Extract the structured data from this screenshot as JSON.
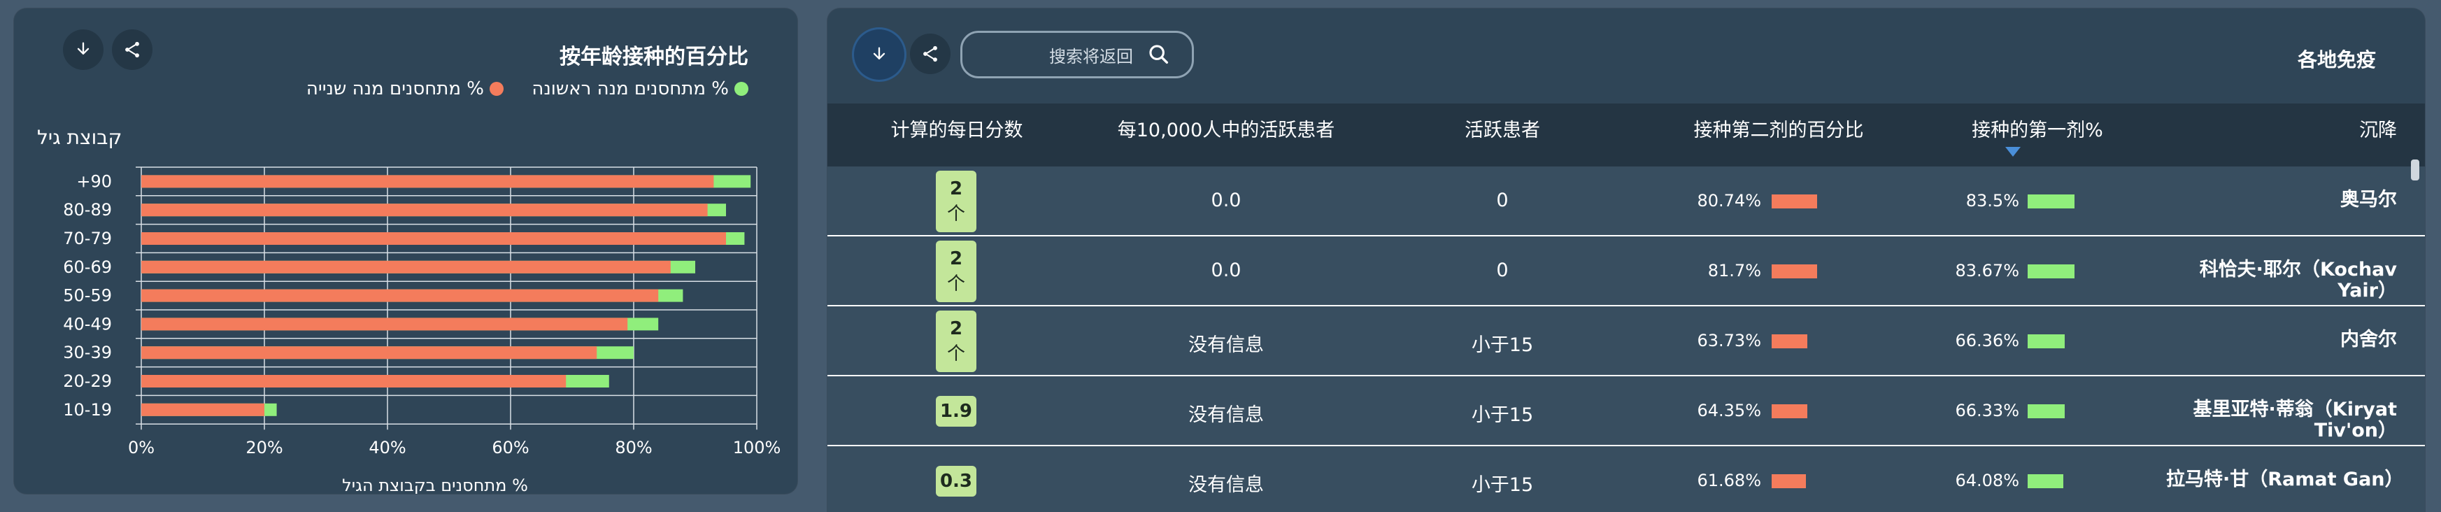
{
  "left_panel": {
    "title": "按年龄接种的百分比",
    "legend": [
      {
        "label": "% מתחסנים מנה ראשונה",
        "color": "#90ee7c"
      },
      {
        "label": "% מתחסנים מנה שנייה",
        "color": "#f47c5c"
      }
    ],
    "y_group_label": "קבוצת גיל",
    "buttons": {
      "download_icon": "download-icon",
      "share_icon": "share-icon"
    }
  },
  "chart_data": {
    "type": "bar",
    "orientation": "horizontal",
    "categories": [
      "+90",
      "80-89",
      "70-79",
      "60-69",
      "50-59",
      "40-49",
      "30-39",
      "20-29",
      "10-19"
    ],
    "series": [
      {
        "name": "% מתחסנים מנה ראשונה",
        "color": "#90ee7c",
        "values": [
          99,
          95,
          98,
          90,
          88,
          84,
          80,
          76,
          22
        ]
      },
      {
        "name": "% מתחסנים מנה שנייה",
        "color": "#f47c5c",
        "values": [
          93,
          92,
          95,
          86,
          84,
          79,
          74,
          69,
          20
        ]
      }
    ],
    "xlabel": "% מתחסנים בקבוצת הגיל",
    "x_ticks": [
      "0%",
      "20%",
      "40%",
      "60%",
      "80%",
      "100%"
    ],
    "xlim": [
      0,
      100
    ],
    "grid": true
  },
  "right_panel": {
    "title": "各地免疫",
    "search_placeholder": "搜索将返回",
    "columns": {
      "city": "沉降",
      "first_dose": "接种的第一剂%",
      "second_dose": "接种第二剂的百分比",
      "active": "活跃患者",
      "active_per_10k": "每10,000人中的活跃患者",
      "daily_score": "计算的每日分数"
    },
    "rows": [
      {
        "city": "奥马尔",
        "first_dose": "83.5%",
        "first_val": 83.5,
        "second_dose": "80.74%",
        "second_val": 80.74,
        "active": "0",
        "active_per_10k": "0.0",
        "score": "2",
        "score_sub": "个"
      },
      {
        "city": "科恰夫·耶尔（Kochav Yair）",
        "first_dose": "83.67%",
        "first_val": 83.67,
        "second_dose": "81.7%",
        "second_val": 81.7,
        "active": "0",
        "active_per_10k": "0.0",
        "score": "2",
        "score_sub": "个"
      },
      {
        "city": "内舍尔",
        "first_dose": "66.36%",
        "first_val": 66.36,
        "second_dose": "63.73%",
        "second_val": 63.73,
        "active": "小于15",
        "active_per_10k": "没有信息",
        "score": "2",
        "score_sub": "个"
      },
      {
        "city": "基里亚特·蒂翁（Kiryat Tiv'on）",
        "first_dose": "66.33%",
        "first_val": 66.33,
        "second_dose": "64.35%",
        "second_val": 64.35,
        "active": "小于15",
        "active_per_10k": "没有信息",
        "score": "1.9",
        "score_sub": ""
      },
      {
        "city": "拉马特·甘（Ramat Gan）",
        "first_dose": "64.08%",
        "first_val": 64.08,
        "second_dose": "61.68%",
        "second_val": 61.68,
        "active": "小于15",
        "active_per_10k": "没有信息",
        "score": "0.3",
        "score_sub": ""
      }
    ]
  }
}
